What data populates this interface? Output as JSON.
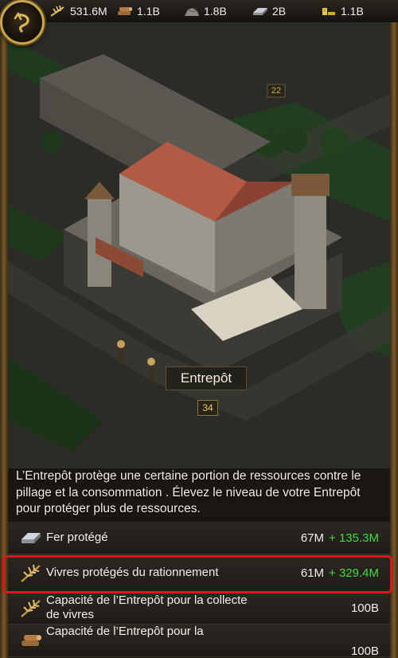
{
  "resources": [
    {
      "icon": "food-wheat-icon",
      "value": "531.6M"
    },
    {
      "icon": "wood-logs-icon",
      "value": "1.1B"
    },
    {
      "icon": "stone-icon",
      "value": "1.8B"
    },
    {
      "icon": "iron-ingot-icon",
      "value": "2B"
    },
    {
      "icon": "silver-icon",
      "value": "1.1B"
    }
  ],
  "scene": {
    "building_name": "Entrepôt",
    "building_level": "34",
    "plot_number": "22"
  },
  "description": "L’Entrepôt protège une certaine portion de ressources contre le pillage et la consommation . Élevez le niveau de votre Entrepôt pour protéger plus de ressources.",
  "stats": [
    {
      "icon": "iron-ingot-icon",
      "label": "Fer protégé",
      "value": "67M",
      "bonus": "+ 135.3M"
    },
    {
      "icon": "food-wheat-icon",
      "label": "Vivres protégés du rationnement",
      "value": "61M",
      "bonus": "+ 329.4M"
    },
    {
      "icon": "food-wheat-icon",
      "label": "Capacité de l’Entrepôt pour la collecte de vivres",
      "value": "100B",
      "bonus": ""
    },
    {
      "icon": "wood-logs-icon",
      "label": "Capacité de l’Entrepôt pour la",
      "value": "100B",
      "bonus": ""
    }
  ],
  "colors": {
    "accent_gold": "#c9a64f",
    "bonus_green": "#3fdc3f",
    "highlight_red": "#e0141a"
  }
}
